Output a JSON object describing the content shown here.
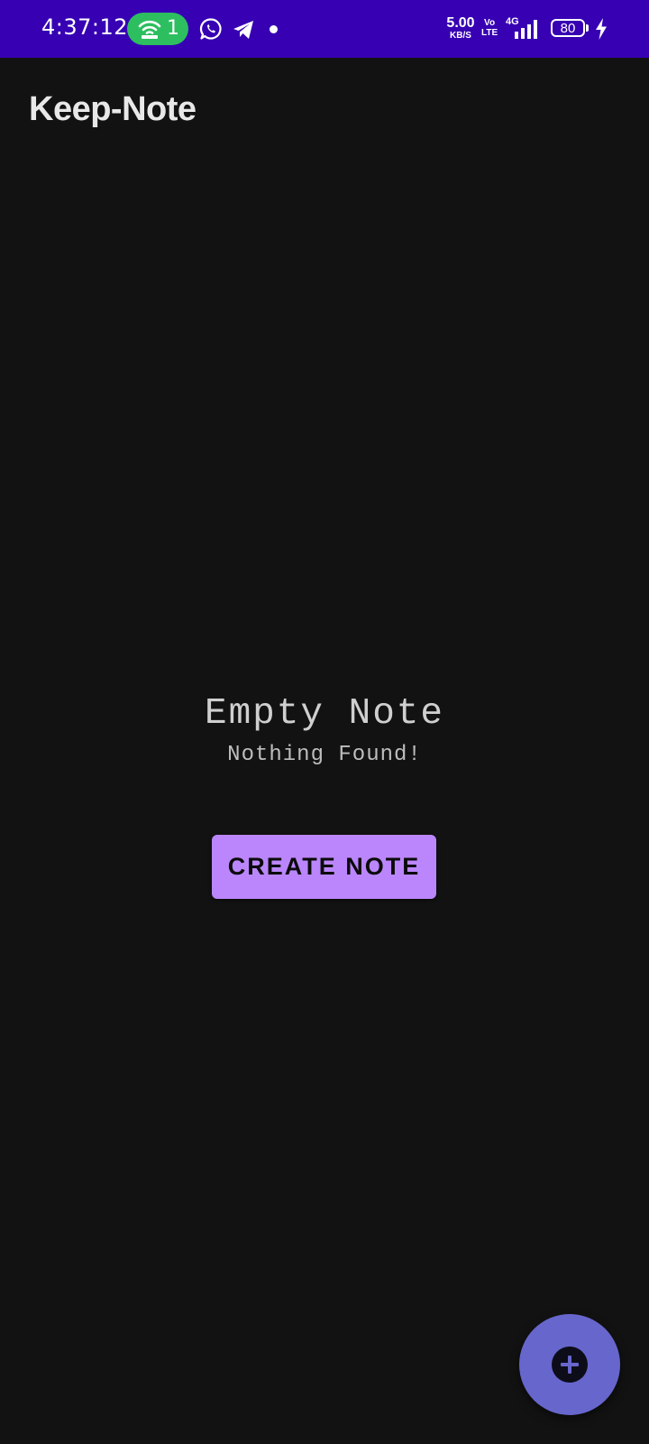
{
  "status_bar": {
    "time": "4:37:12",
    "hotspot_count": "1",
    "net_speed_value": "5.00",
    "net_speed_unit": "KB/S",
    "volte_top": "Vo",
    "volte_bottom": "LTE",
    "network_type": "4G",
    "battery_level": "80",
    "icons": [
      "hotspot-icon",
      "whatsapp-icon",
      "telegram-icon",
      "notification-dot-icon",
      "signal-icon",
      "battery-icon",
      "charging-icon"
    ]
  },
  "app": {
    "title": "Keep-Note"
  },
  "empty_state": {
    "title": "Empty Note",
    "subtitle": "Nothing Found!",
    "button_label": "CREATE NOTE"
  },
  "fab": {
    "icon": "add-icon"
  },
  "colors": {
    "status_bar": "#3700b3",
    "background": "#121212",
    "accent": "#bb86fc",
    "fab": "#6766cc",
    "hotspot_pill": "#2dbe60"
  }
}
